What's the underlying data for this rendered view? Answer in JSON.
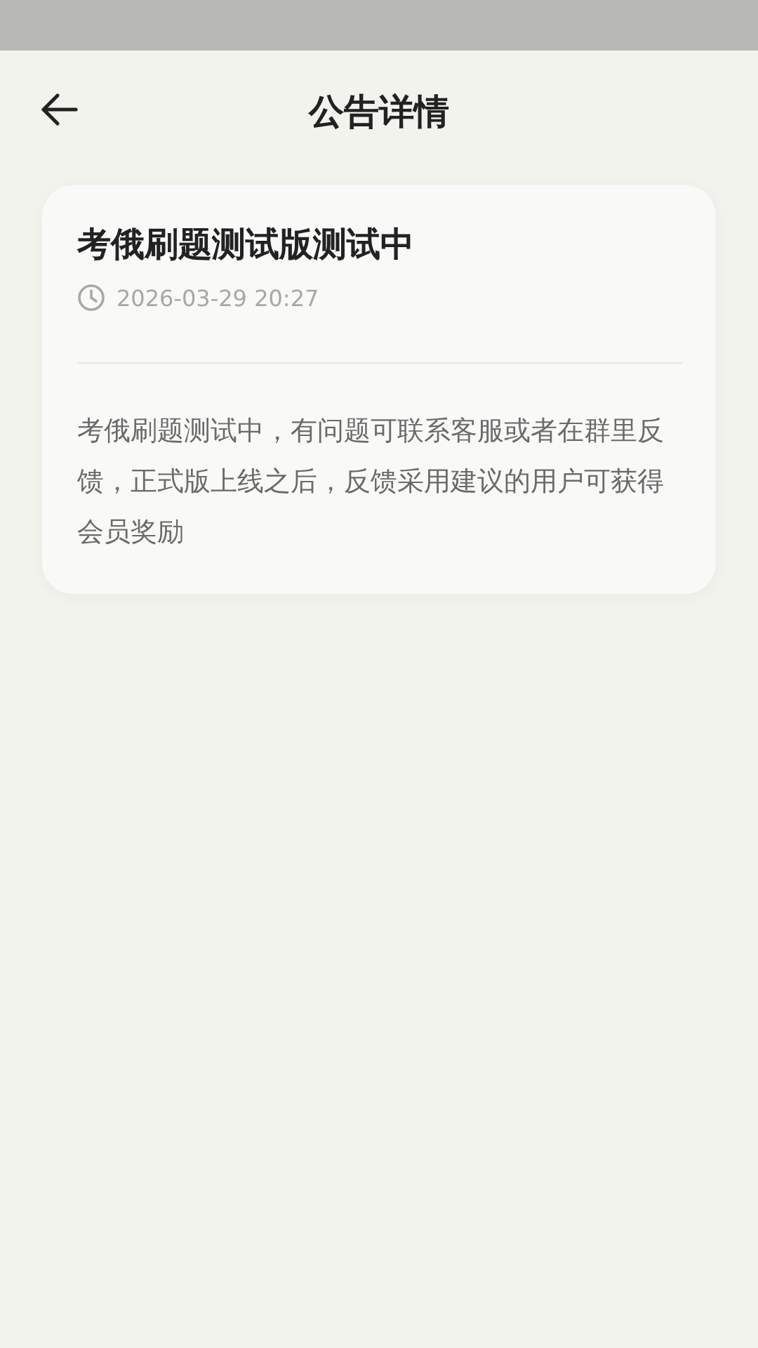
{
  "header": {
    "title": "公告详情"
  },
  "announcement": {
    "title": "考俄刷题测试版测试中",
    "time": "2026-03-29 20:27",
    "body": "考俄刷题测试中，有问题可联系客服或者在群里反馈，正式版上线之后，反馈采用建议的用户可获得会员奖励"
  }
}
